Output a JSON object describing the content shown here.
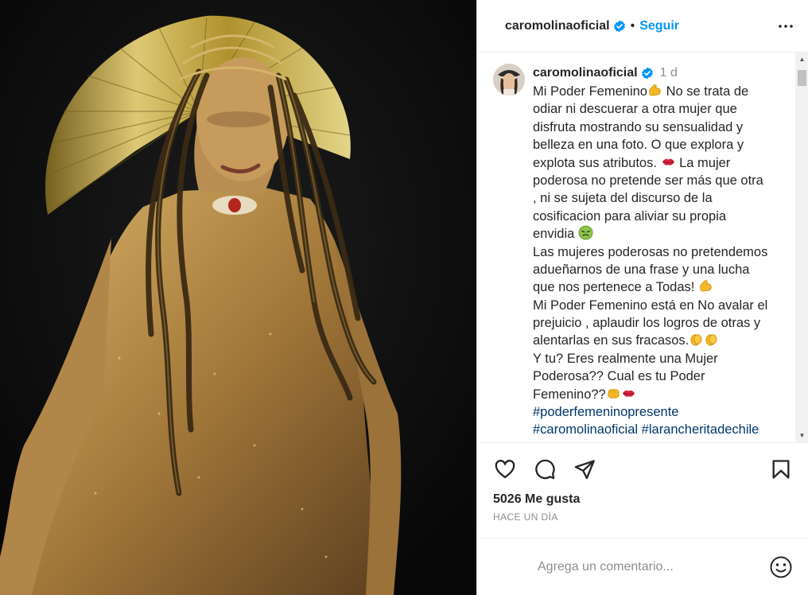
{
  "post": {
    "username": "caromolinaoficial",
    "follow_label": "Seguir",
    "dot": "•",
    "time": "1 d",
    "caption_lines": [
      "Mi Poder Femenino",
      "odiar ni descuerar a otra mujer que",
      "disfruta mostrando su sensualidad y",
      "belleza en una foto. O que explora y",
      "explota sus atributos.",
      "poderosa no pretende ser más que otra",
      ", ni se sujeta del discurso de la",
      "cosificacion para aliviar su propia",
      "envidia",
      "Las mujeres poderosas no pretendemos",
      "adueñarnos de una frase y una lucha",
      "que nos pertenece a Todas!",
      "Mi Poder Femenino está en No avalar el",
      "prejuicio , aplaudir los logros de otras y",
      "alentarlas en sus fracasos.",
      "Y tu? Eres realmente una Mujer",
      "Poderosa?? Cual es tu Poder",
      "Femenino??"
    ],
    "caption_line1_tail": " No se trata de",
    "caption_line5_tail": " La mujer",
    "hashtag1": "#poderfemeninopresente",
    "hashtag2": "#caromolinaoficial",
    "hashtag3": "#larancheritadechile",
    "likes": "5026 Me gusta",
    "ago": "HACE UN DÍA",
    "comment_placeholder": "Agrega un comentario..."
  },
  "colors": {
    "accent": "#0095f6",
    "verified": "#0095f6",
    "hashtag": "#00376b",
    "muted": "#8e8e8e",
    "text": "#262626"
  },
  "icons": {
    "verified": "verified-badge-icon",
    "more": "more-options-icon",
    "like": "heart-icon",
    "comment": "comment-bubble-icon",
    "share": "paper-plane-icon",
    "save": "bookmark-icon",
    "emoji": "smiley-icon",
    "muscle": "flexed-biceps-emoji",
    "lips": "kiss-mark-emoji",
    "nauseated": "nauseated-face-emoji",
    "clap": "clapping-hands-emoji",
    "fist": "oncoming-fist-emoji"
  }
}
